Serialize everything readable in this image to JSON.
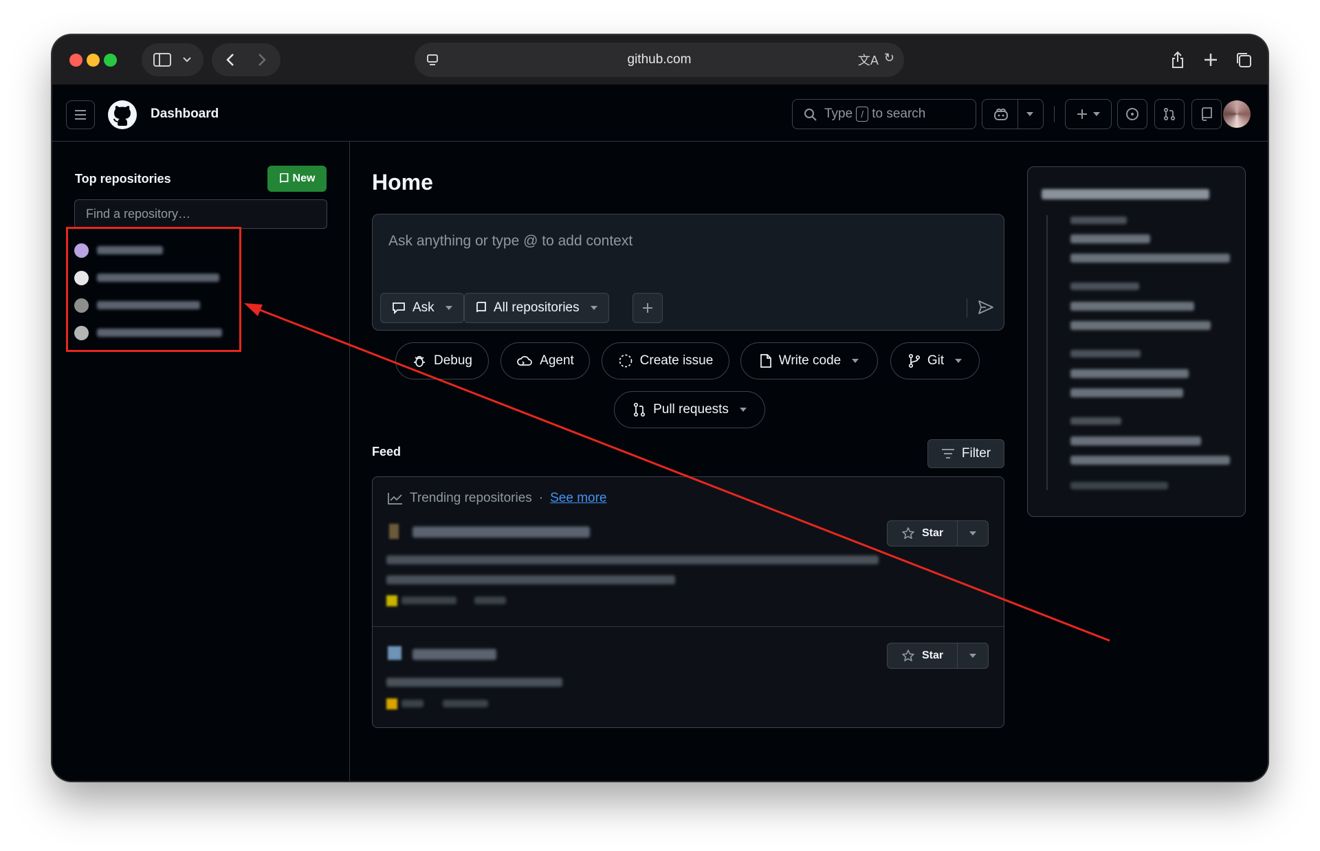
{
  "browser": {
    "url": "github.com",
    "tab_overview_icon": "tabs-icon"
  },
  "header": {
    "title": "Dashboard",
    "search_prefix": "Type",
    "search_key": "/",
    "search_suffix": "to search"
  },
  "sidebar": {
    "title": "Top repositories",
    "new_label": "New",
    "find_placeholder": "Find a repository…",
    "repos": [
      {
        "name_blurred": true,
        "avatar_color": "#b9a3e3"
      },
      {
        "name_blurred": true,
        "avatar_color": "#e6e6e6"
      },
      {
        "name_blurred": true,
        "avatar_color": "#8e8e8e"
      },
      {
        "name_blurred": true,
        "avatar_color": "#b5b5b5"
      }
    ]
  },
  "main": {
    "title": "Home",
    "composer_placeholder": "Ask anything or type @ to add context",
    "ask_label": "Ask",
    "repos_label": "All repositories",
    "actions": {
      "debug": "Debug",
      "agent": "Agent",
      "create_issue": "Create issue",
      "write_code": "Write code",
      "git": "Git",
      "pull_requests": "Pull requests"
    },
    "feed_title": "Feed",
    "filter_label": "Filter",
    "trending_label": "Trending repositories",
    "see_more": "See more",
    "star_label": "Star"
  },
  "colors": {
    "accent_green": "#238636",
    "link_blue": "#4493f8",
    "annotation_red": "#e8271f",
    "background": "#010409"
  }
}
